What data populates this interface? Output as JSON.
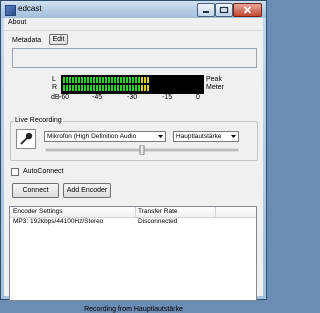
{
  "window": {
    "title": "edcast"
  },
  "menu": {
    "about": "About"
  },
  "metadata": {
    "label": "Metadata",
    "edit_button": "Edit",
    "text_value": ""
  },
  "meter": {
    "left_channel_label": "L",
    "right_channel_label": "R",
    "peak_label": "Peak",
    "meter_label": "Meter",
    "db_label": "dB",
    "scale": [
      "-60",
      "-45",
      "-30",
      "-15",
      "0"
    ],
    "left_level": 0.62,
    "right_level": 0.62,
    "colors": {
      "low": "#2fd12f",
      "high": "#d9d11f",
      "background": "#000000"
    }
  },
  "live_recording": {
    "group_label": "Live Recording",
    "input_device": "Mikrofon (High Definition Audio",
    "mixer_control": "Hauptlautstärke",
    "volume_level": 0.5
  },
  "auto_connect": {
    "label": "AutoConnect",
    "checked": false
  },
  "actions": {
    "connect": "Connect",
    "add_encoder": "Add Encoder"
  },
  "encoders": {
    "columns": [
      "Encoder Settings",
      "Transfer Rate"
    ],
    "rows": [
      {
        "settings": "MP3: 192kbps/44100Hz/Stereo",
        "transfer_rate": "Disconnected"
      }
    ]
  },
  "status": {
    "text": "Recording from Hauptlautstärke"
  }
}
